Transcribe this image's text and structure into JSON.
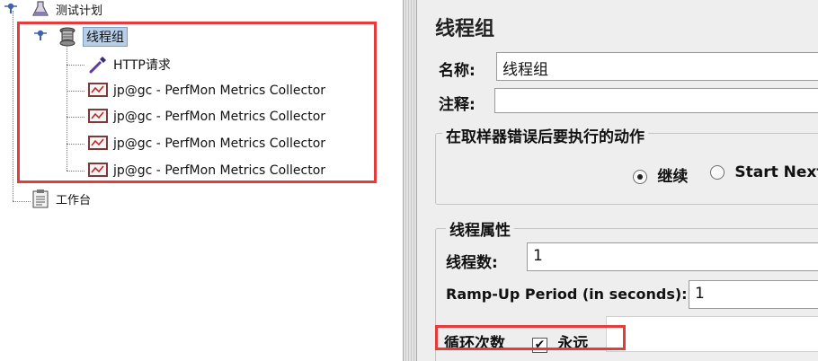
{
  "tree": {
    "root_label": "测试计划",
    "thread_group_label": "线程组",
    "children": [
      {
        "label": "HTTP请求",
        "icon": "pipette-icon"
      },
      {
        "label": "jp@gc - PerfMon Metrics Collector",
        "icon": "monitor-icon"
      },
      {
        "label": "jp@gc - PerfMon Metrics Collector",
        "icon": "monitor-icon"
      },
      {
        "label": "jp@gc - PerfMon Metrics Collector",
        "icon": "monitor-icon"
      },
      {
        "label": "jp@gc - PerfMon Metrics Collector",
        "icon": "monitor-icon"
      }
    ],
    "workbench_label": "工作台"
  },
  "form": {
    "title": "线程组",
    "name_label": "名称:",
    "name_value": "线程组",
    "comment_label": "注释:",
    "comment_value": "",
    "error_action": {
      "title": "在取样器错误后要执行的动作",
      "option_continue": "继续",
      "option_start_next": "Start Next",
      "selected": "继续"
    },
    "thread_props": {
      "title": "线程属性",
      "threads_label": "线程数:",
      "threads_value": "1",
      "rampup_label": "Ramp-Up Period (in seconds):",
      "rampup_value": "1",
      "loop_label": "循环次数",
      "forever_label": "永远",
      "forever_checked": true
    }
  },
  "colors": {
    "highlight_box": "#e63b3b",
    "selection": "#b9cfe8",
    "panel_bg": "#eeeeee"
  }
}
